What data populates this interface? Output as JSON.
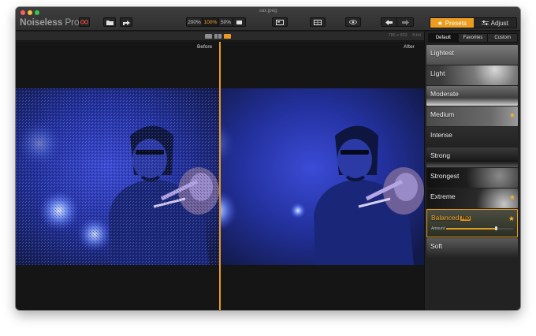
{
  "window": {
    "title": "sax.jpeg"
  },
  "app": {
    "name_left": "Noiseless",
    "name_right": "Pro"
  },
  "toolbar": {
    "zoom_options": [
      "200%",
      "100%",
      "50%"
    ],
    "zoom_active": "100%"
  },
  "top_tabs": [
    {
      "label": "Presets",
      "icon": "star-icon",
      "active": true
    },
    {
      "label": "Adjust",
      "icon": "sliders-icon",
      "active": false
    }
  ],
  "image_info": {
    "dimensions": "786 x 822",
    "bit_depth": "8-bit"
  },
  "preview": {
    "before_label": "Before",
    "after_label": "After"
  },
  "preset_tabs": [
    {
      "label": "Default",
      "active": true
    },
    {
      "label": "Favorites",
      "active": false
    },
    {
      "label": "Custom",
      "active": false
    }
  ],
  "presets": [
    {
      "name": "Lightest",
      "favorite": false,
      "pro": false
    },
    {
      "name": "Light",
      "favorite": false,
      "pro": false
    },
    {
      "name": "Moderate",
      "favorite": false,
      "pro": false
    },
    {
      "name": "Medium",
      "favorite": true,
      "pro": false
    },
    {
      "name": "Intense",
      "favorite": false,
      "pro": false
    },
    {
      "name": "Strong",
      "favorite": false,
      "pro": false
    },
    {
      "name": "Strongest",
      "favorite": false,
      "pro": false
    },
    {
      "name": "Extreme",
      "favorite": true,
      "pro": false
    },
    {
      "name": "Balanced",
      "favorite": true,
      "pro": true,
      "selected": true,
      "pro_label": "PRO",
      "amount_label": "Amount",
      "amount_value": 0.75
    },
    {
      "name": "Soft",
      "favorite": false,
      "pro": false
    }
  ],
  "colors": {
    "accent": "#e79b23",
    "window_bg": "#1a1a1a",
    "panel_bg": "#222222"
  }
}
